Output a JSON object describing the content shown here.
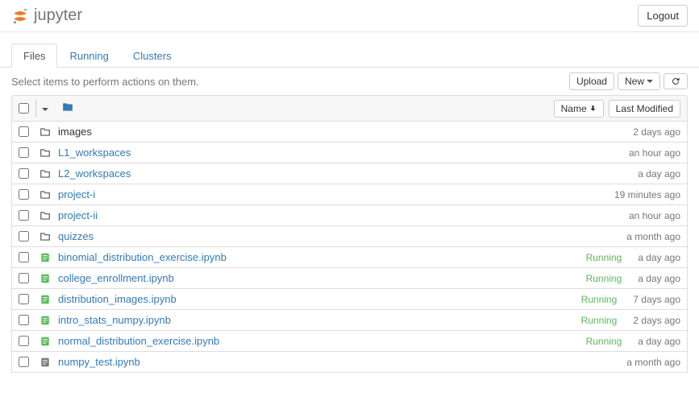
{
  "header": {
    "logo_text": "jupyter",
    "logout_label": "Logout"
  },
  "tabs": {
    "files": "Files",
    "running": "Running",
    "clusters": "Clusters"
  },
  "toolbar": {
    "instruction": "Select items to perform actions on them.",
    "upload_label": "Upload",
    "new_label": "New"
  },
  "list_header": {
    "sort_name": "Name",
    "sort_modified": "Last Modified"
  },
  "items": [
    {
      "type": "folder",
      "name": "images",
      "status": "",
      "modified": "2 days ago",
      "link_color": "black"
    },
    {
      "type": "folder",
      "name": "L1_workspaces",
      "status": "",
      "modified": "an hour ago",
      "link_color": "blue"
    },
    {
      "type": "folder",
      "name": "L2_workspaces",
      "status": "",
      "modified": "a day ago",
      "link_color": "blue"
    },
    {
      "type": "folder",
      "name": "project-i",
      "status": "",
      "modified": "19 minutes ago",
      "link_color": "blue"
    },
    {
      "type": "folder",
      "name": "project-ii",
      "status": "",
      "modified": "an hour ago",
      "link_color": "blue"
    },
    {
      "type": "folder",
      "name": "quizzes",
      "status": "",
      "modified": "a month ago",
      "link_color": "blue"
    },
    {
      "type": "notebook",
      "name": "binomial_distribution_exercise.ipynb",
      "status": "Running",
      "modified": "a day ago",
      "running": true
    },
    {
      "type": "notebook",
      "name": "college_enrollment.ipynb",
      "status": "Running",
      "modified": "a day ago",
      "running": true
    },
    {
      "type": "notebook",
      "name": "distribution_images.ipynb",
      "status": "Running",
      "modified": "7 days ago",
      "running": true
    },
    {
      "type": "notebook",
      "name": "intro_stats_numpy.ipynb",
      "status": "Running",
      "modified": "2 days ago",
      "running": true
    },
    {
      "type": "notebook",
      "name": "normal_distribution_exercise.ipynb",
      "status": "Running",
      "modified": "a day ago",
      "running": true
    },
    {
      "type": "notebook",
      "name": "numpy_test.ipynb",
      "status": "",
      "modified": "a month ago",
      "running": false
    }
  ]
}
